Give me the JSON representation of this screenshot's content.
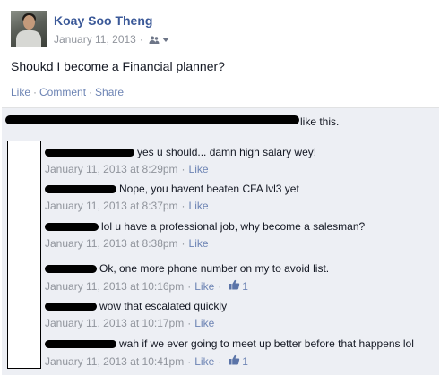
{
  "post": {
    "author": "Koay Soo Theng",
    "date": "January 11, 2013",
    "audience_icon": "friends-icon",
    "text": "Shoukd I become a Financial planner?",
    "actions": {
      "like": "Like",
      "comment": "Comment",
      "share": "Share"
    }
  },
  "likes_summary": {
    "text": "like this."
  },
  "comments": [
    {
      "text": "yes u should... damn high salary wey!",
      "time": "January 11, 2013 at 8:29pm",
      "like": "Like"
    },
    {
      "text": "Nope, you havent beaten CFA lvl3 yet",
      "time": "January 11, 2013 at 8:37pm",
      "like": "Like"
    },
    {
      "text": "lol u have a professional job, why become a salesman?",
      "time": "January 11, 2013 at 8:38pm",
      "like": "Like"
    },
    {
      "text": "Ok, one more phone number on my to avoid list.",
      "time": "January 11, 2013 at 10:16pm",
      "like": "Like",
      "like_count": "1"
    },
    {
      "text": "wow that escalated quickly",
      "time": "January 11, 2013 at 10:17pm",
      "like": "Like"
    },
    {
      "text": "wah if we ever going to meet up better before that happens lol",
      "time": "January 11, 2013 at 10:41pm",
      "like": "Like",
      "like_count": "1"
    }
  ],
  "colors": {
    "link": "#3b5998",
    "action_link": "#6d84b4",
    "meta": "#90949c",
    "comments_bg": "#edeff4"
  }
}
